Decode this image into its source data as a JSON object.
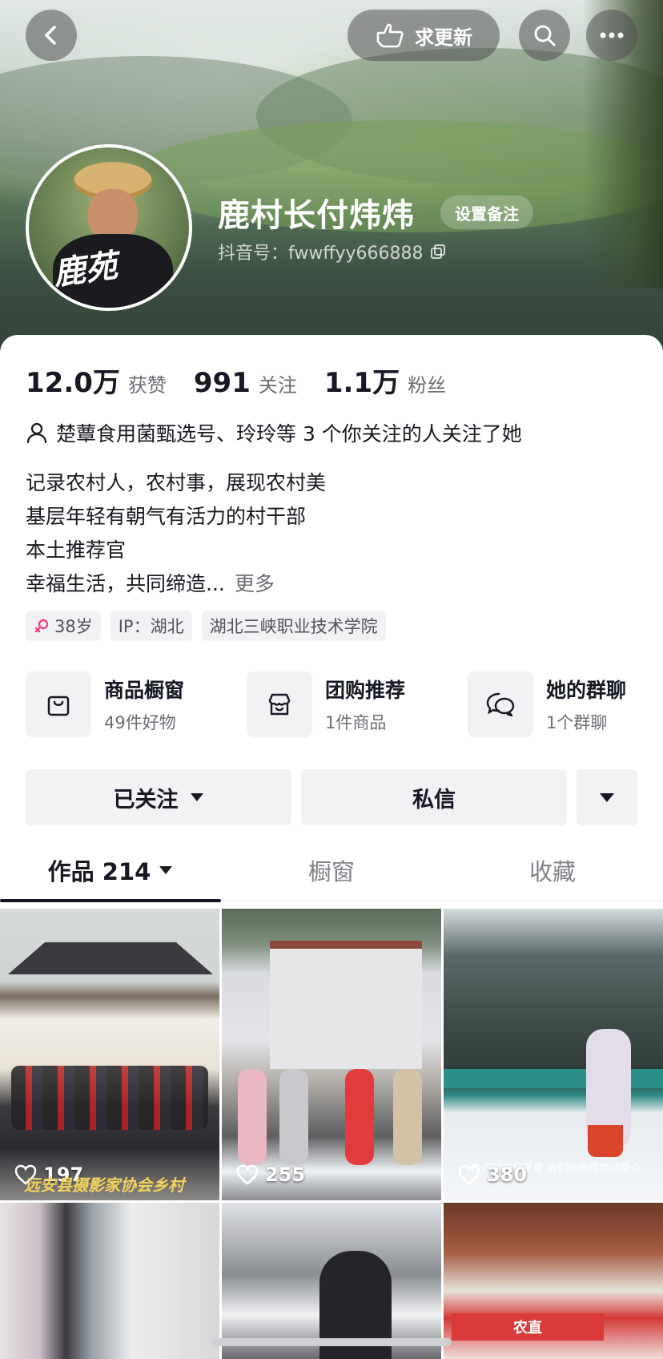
{
  "header": {
    "update_label": "求更新",
    "name": "鹿村长付炜炜",
    "remark_label": "设置备注",
    "douyin_id": "抖音号：fwwffyy666888",
    "avatar_text": "鹿苑"
  },
  "stats": [
    {
      "num": "12.0万",
      "label": "获赞"
    },
    {
      "num": "991",
      "label": "关注"
    },
    {
      "num": "1.1万",
      "label": "粉丝"
    }
  ],
  "mutual": "楚蕈食用菌甄选号、玲玲等 3 个你关注的人关注了她",
  "bio": {
    "lines": [
      "记录农村人，农村事，展现农村美",
      "基层年轻有朝气有活力的村干部",
      "本土推荐官",
      "幸福生活，共同缔造..."
    ],
    "more": "更多"
  },
  "tags": {
    "age": "38岁",
    "ip": "IP：湖北",
    "school": "湖北三峡职业技术学院"
  },
  "services": [
    {
      "title": "商品橱窗",
      "sub": "49件好物",
      "icon": "bag-icon"
    },
    {
      "title": "团购推荐",
      "sub": "1件商品",
      "icon": "store-icon"
    },
    {
      "title": "她的群聊",
      "sub": "1个群聊",
      "icon": "chat-icon"
    }
  ],
  "actions": {
    "followed": "已关注",
    "message": "私信"
  },
  "tabs": {
    "works": "作品 214",
    "showcase": "橱窗",
    "favorites": "收藏"
  },
  "grid": [
    {
      "likes": "197",
      "caption": "远安县摄影家协会乡村"
    },
    {
      "likes": "255"
    },
    {
      "likes": "380",
      "caption": "在今后的日子里 我们会继续发动群众"
    },
    {},
    {},
    {
      "caption": "农直"
    }
  ],
  "colors": {
    "text_primary": "#161823",
    "text_secondary": "#6b6d74",
    "chip_bg": "#f2f2f4",
    "female_icon": "#f5467c"
  }
}
